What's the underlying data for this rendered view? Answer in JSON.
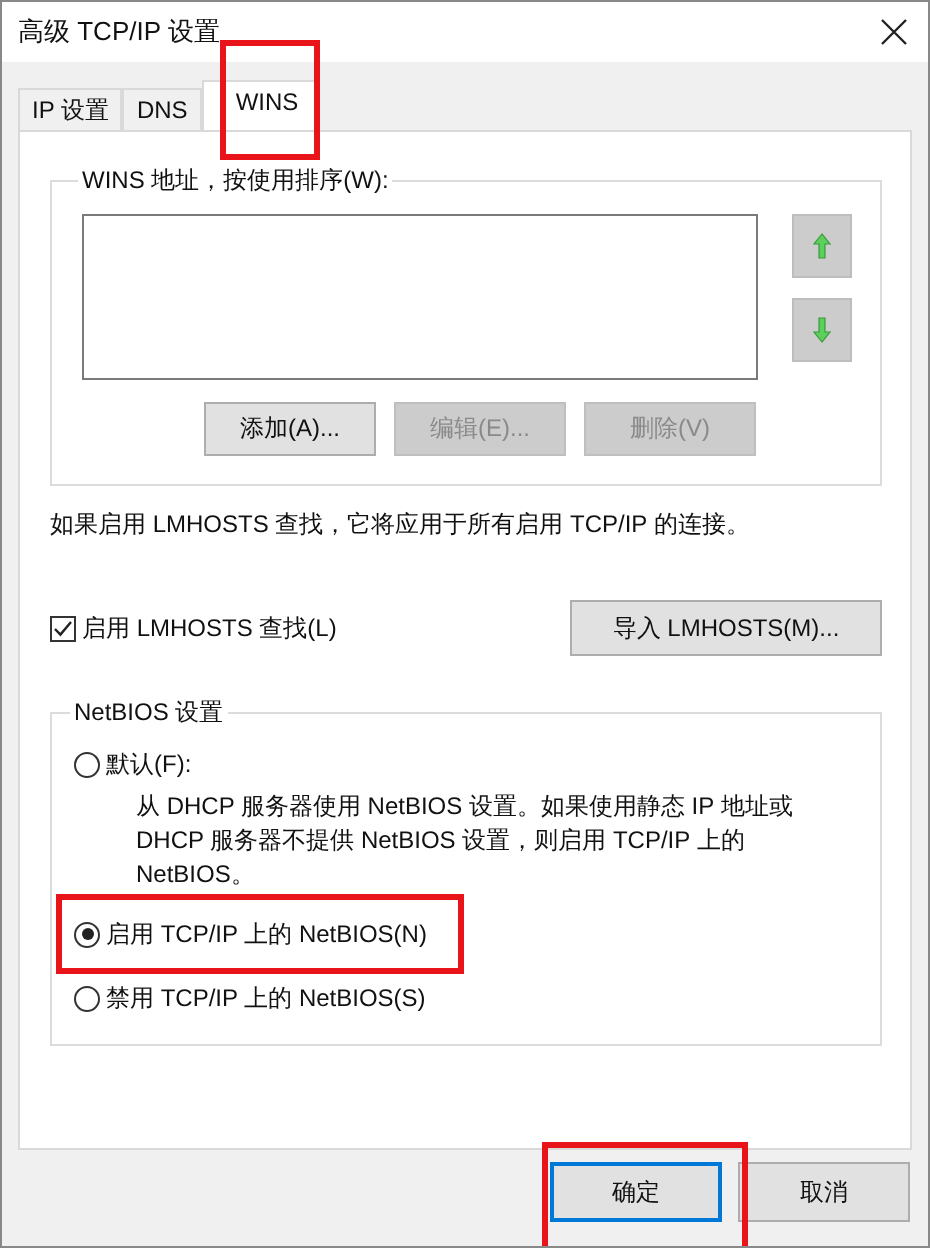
{
  "window": {
    "title": "高级 TCP/IP 设置"
  },
  "tabs": [
    {
      "label": "IP 设置",
      "selected": false
    },
    {
      "label": "DNS",
      "selected": false
    },
    {
      "label": "WINS",
      "selected": true
    }
  ],
  "wins": {
    "legend": "WINS 地址，按使用排序(W):",
    "buttons": [
      {
        "label": "添加(A)...",
        "disabled": false
      },
      {
        "label": "编辑(E)...",
        "disabled": true
      },
      {
        "label": "删除(V)",
        "disabled": true
      }
    ]
  },
  "info_text": "如果启用 LMHOSTS 查找，它将应用于所有启用 TCP/IP 的连接。",
  "lmhosts": {
    "label": "启用 LMHOSTS 查找(L)",
    "checked": true
  },
  "import_button": "导入 LMHOSTS(M)...",
  "netbios": {
    "legend": "NetBIOS 设置",
    "options": [
      {
        "label": "默认(F):",
        "selected": false,
        "description": "从 DHCP 服务器使用 NetBIOS 设置。如果使用静态 IP 地址或 DHCP 服务器不提供 NetBIOS 设置，则启用 TCP/IP 上的 NetBIOS。"
      },
      {
        "label": "启用 TCP/IP 上的 NetBIOS(N)",
        "selected": true
      },
      {
        "label": "禁用 TCP/IP 上的 NetBIOS(S)",
        "selected": false
      }
    ]
  },
  "buttons": [
    {
      "label": "确定",
      "default": true
    },
    {
      "label": "取消",
      "default": false
    }
  ]
}
